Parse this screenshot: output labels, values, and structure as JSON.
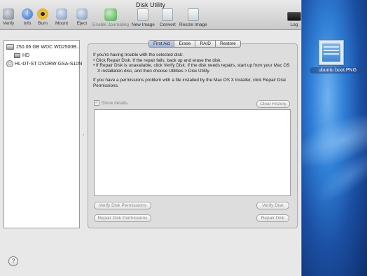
{
  "window": {
    "title": "Disk Utility"
  },
  "toolbar": {
    "items": [
      {
        "label": "Verify",
        "icon": "verify-icon"
      },
      {
        "label": "Info",
        "icon": "info-icon"
      },
      {
        "label": "Burn",
        "icon": "burn-icon"
      },
      {
        "label": "Mount",
        "icon": "mount-icon"
      },
      {
        "label": "Eject",
        "icon": "eject-icon"
      },
      {
        "label": "Enable Journaling",
        "icon": "journal-icon"
      },
      {
        "label": "New Image",
        "icon": "new-image-icon"
      },
      {
        "label": "Convert",
        "icon": "convert-icon"
      },
      {
        "label": "Resize Image",
        "icon": "resize-image-icon"
      },
      {
        "label": "Log",
        "icon": "log-icon"
      }
    ],
    "info_glyph": "i"
  },
  "sidebar": {
    "items": [
      {
        "label": "250.06 GB WDC WD2500B..."
      },
      {
        "label": "HD"
      },
      {
        "label": "HL-DT-ST DVDRW GSA-S10N"
      }
    ]
  },
  "tabs": [
    "First Aid",
    "Erase",
    "RAID",
    "Restore"
  ],
  "first_aid": {
    "intro": "If you're having trouble with the selected disk:",
    "bullet1": "• Click Repair Disk. If the repair fails, back up and erase the disk.",
    "bullet2": "• If Repair Disk is unavailable, click Verify Disk. If the disk needs repairs, start up from your Mac OS X installation disc, and then choose Utilities > Disk Utility.",
    "permissions": "If you have a permissions problem with a file installed by the Mac OS X installer, click Repair Disk Permissions.",
    "show_details": "Show details",
    "check_mark": "✓",
    "clear_history": "Clear History",
    "verify_permissions": "Verify Disk Permissions",
    "repair_permissions": "Repair Disk Permissions",
    "verify_disk": "Verify Disk",
    "repair_disk": "Repair Disk"
  },
  "help_glyph": "?",
  "desktop": {
    "file_label": "ubuntu boot.PNG"
  }
}
